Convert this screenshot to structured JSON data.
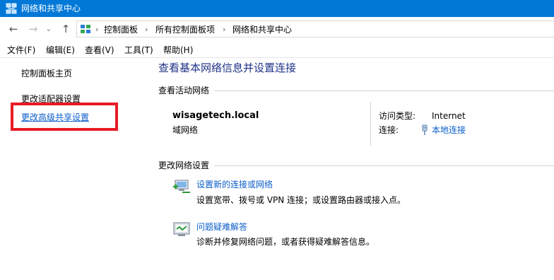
{
  "window": {
    "title": "网络和共享中心"
  },
  "address": {
    "crumbs": [
      "控制面板",
      "所有控制面板项",
      "网络和共享中心"
    ],
    "icon": "control-panel-icon"
  },
  "nav": {
    "back": "←",
    "forward": "→",
    "history": "⌄",
    "up": "↑",
    "sep": "›"
  },
  "menu": [
    "文件(F)",
    "编辑(E)",
    "查看(V)",
    "工具(T)",
    "帮助(H)"
  ],
  "sidebar": {
    "items": [
      {
        "label": "控制面板主页"
      },
      {
        "label": "更改适配器设置"
      },
      {
        "label": "更改高级共享设置",
        "active": true
      }
    ],
    "highlight_color": "#e81c24"
  },
  "main": {
    "heading": "查看基本网络信息并设置连接",
    "active_networks": {
      "section": "查看活动网络",
      "name": "wisagetech.local",
      "type": "域网络",
      "access_type_label": "访问类型:",
      "access_type_value": "Internet",
      "connection_label": "连接:",
      "connection_value": "本地连接"
    },
    "change_settings": {
      "section": "更改网络设置",
      "tasks": [
        {
          "link": "设置新的连接或网络",
          "desc": "设置宽带、拨号或 VPN 连接；或设置路由器或接入点。",
          "icon": "new-connection-icon"
        },
        {
          "link": "问题疑难解答",
          "desc": "诊断并修复网络问题，或者获得疑难解答信息。",
          "icon": "troubleshoot-icon"
        }
      ]
    }
  },
  "colors": {
    "titlebar": "#0078d7",
    "link": "#0b5ec9",
    "heading": "#1e3287"
  }
}
